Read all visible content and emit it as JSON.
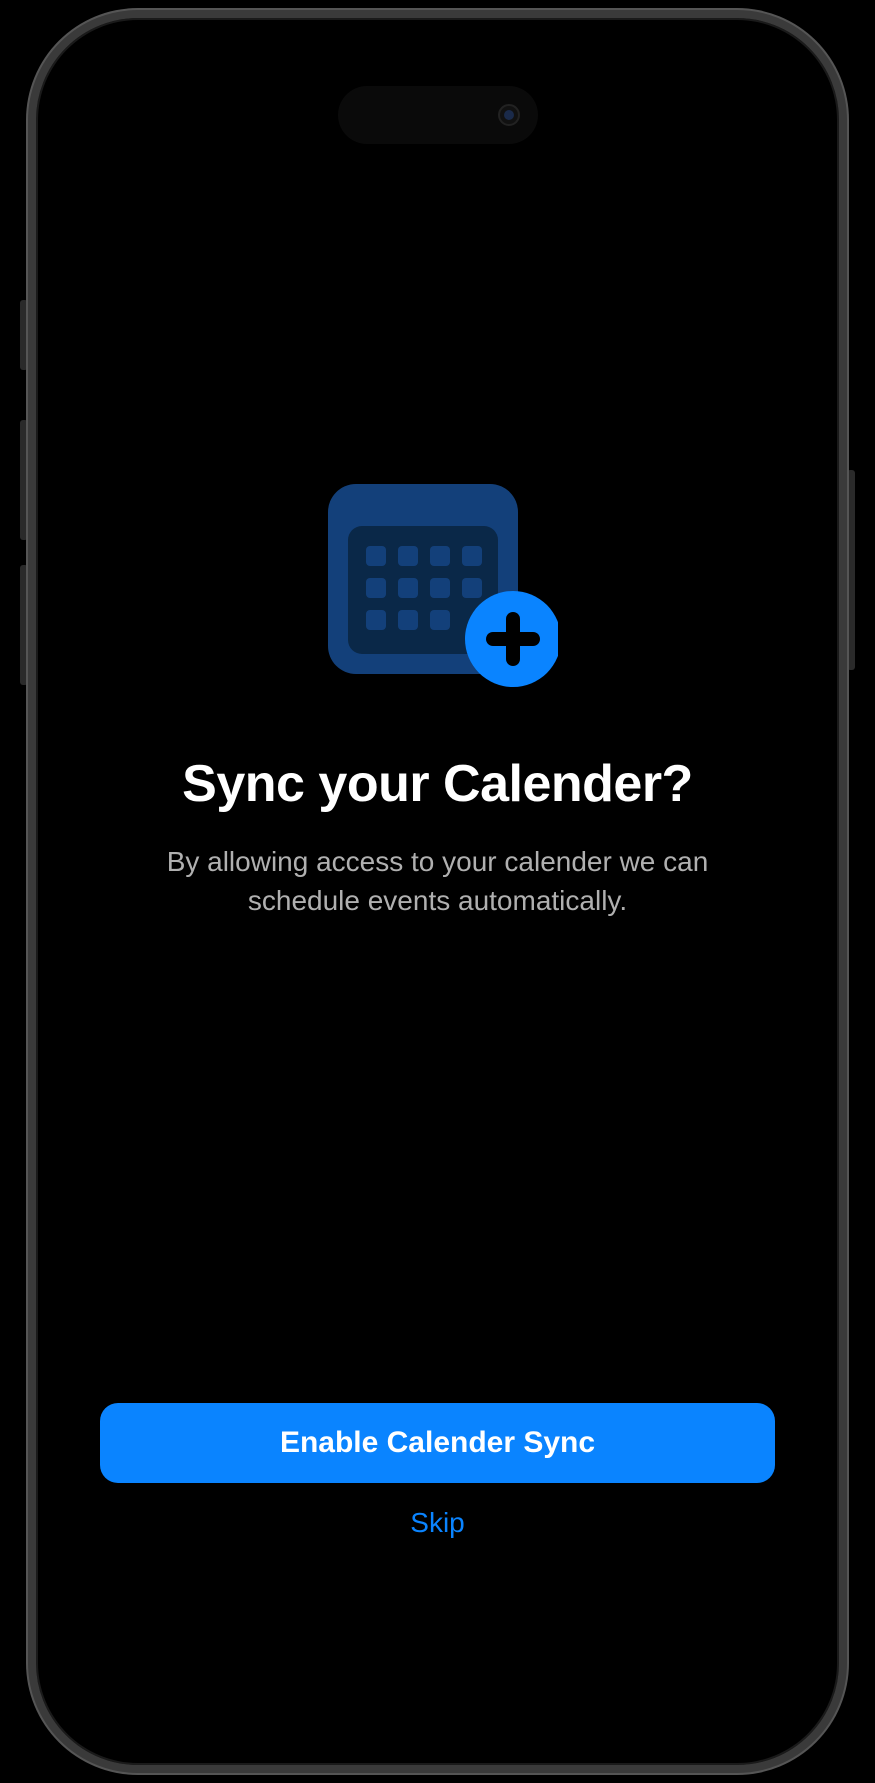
{
  "hero": {
    "title": "Sync your Calender?",
    "subtitle": "By allowing access to your calender we can schedule events automatically."
  },
  "actions": {
    "primary_label": "Enable Calender Sync",
    "skip_label": "Skip"
  },
  "colors": {
    "accent": "#0a84ff",
    "icon_dark": "#13407a",
    "icon_darker": "#0a2848"
  }
}
